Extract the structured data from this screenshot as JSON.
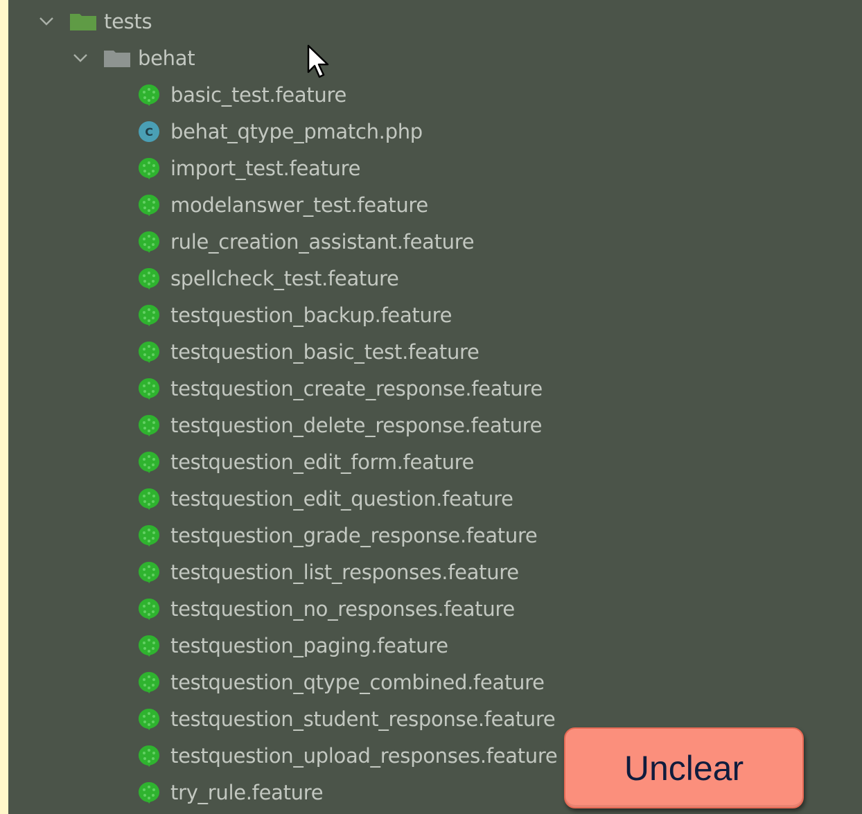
{
  "tree": {
    "root": {
      "label": "tests",
      "folder_color": "#5f9b45"
    },
    "child": {
      "label": "behat",
      "folder_color": "#8e9491"
    },
    "files": [
      {
        "label": "basic_test.feature",
        "icon": "cucumber-icon"
      },
      {
        "label": "behat_qtype_pmatch.php",
        "icon": "php-class-icon"
      },
      {
        "label": "import_test.feature",
        "icon": "cucumber-icon"
      },
      {
        "label": "modelanswer_test.feature",
        "icon": "cucumber-icon"
      },
      {
        "label": "rule_creation_assistant.feature",
        "icon": "cucumber-icon"
      },
      {
        "label": "spellcheck_test.feature",
        "icon": "cucumber-icon"
      },
      {
        "label": "testquestion_backup.feature",
        "icon": "cucumber-icon"
      },
      {
        "label": "testquestion_basic_test.feature",
        "icon": "cucumber-icon"
      },
      {
        "label": "testquestion_create_response.feature",
        "icon": "cucumber-icon"
      },
      {
        "label": "testquestion_delete_response.feature",
        "icon": "cucumber-icon"
      },
      {
        "label": "testquestion_edit_form.feature",
        "icon": "cucumber-icon"
      },
      {
        "label": "testquestion_edit_question.feature",
        "icon": "cucumber-icon"
      },
      {
        "label": "testquestion_grade_response.feature",
        "icon": "cucumber-icon"
      },
      {
        "label": "testquestion_list_responses.feature",
        "icon": "cucumber-icon"
      },
      {
        "label": "testquestion_no_responses.feature",
        "icon": "cucumber-icon"
      },
      {
        "label": "testquestion_paging.feature",
        "icon": "cucumber-icon"
      },
      {
        "label": "testquestion_qtype_combined.feature",
        "icon": "cucumber-icon"
      },
      {
        "label": "testquestion_student_response.feature",
        "icon": "cucumber-icon"
      },
      {
        "label": "testquestion_upload_responses.feature",
        "icon": "cucumber-icon"
      },
      {
        "label": "try_rule.feature",
        "icon": "cucumber-icon"
      }
    ]
  },
  "badge": {
    "label": "Unclear",
    "color": "#fb8f7c"
  },
  "colors": {
    "panel_bg": "#4b5449",
    "text": "#c3c8c1",
    "cucumber": "#2fb32f",
    "php": "#4a9fb5",
    "page_bg": "#fff7c9"
  }
}
